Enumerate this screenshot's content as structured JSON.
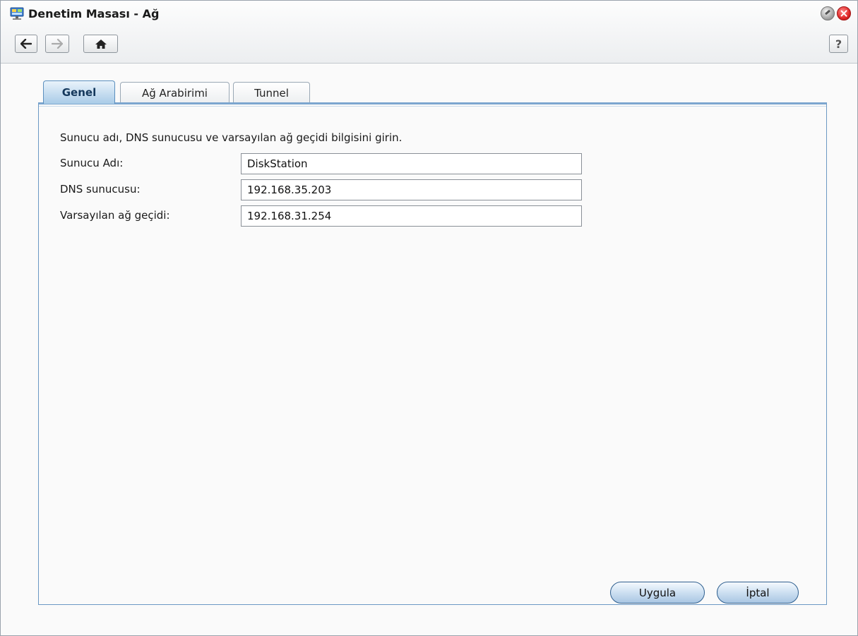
{
  "window": {
    "title": "Denetim Masası - Ağ",
    "icon": "network-monitor-icon",
    "controls": [
      "minimize-icon",
      "close-icon"
    ]
  },
  "toolbar": {
    "back_icon": "arrow-left-icon",
    "forward_icon": "arrow-right-icon",
    "home_icon": "home-icon",
    "help_label": "?"
  },
  "tabs": [
    {
      "label": "Genel",
      "active": true
    },
    {
      "label": "Ağ Arabirimi",
      "active": false
    },
    {
      "label": "Tunnel",
      "active": false
    }
  ],
  "form": {
    "description": "Sunucu adı, DNS sunucusu ve varsayılan ağ geçidi bilgisini girin.",
    "fields": [
      {
        "label": "Sunucu Adı:",
        "value": "DiskStation"
      },
      {
        "label": "DNS sunucusu:",
        "value": "192.168.35.203"
      },
      {
        "label": "Varsayılan ağ geçidi:",
        "value": "192.168.31.254"
      }
    ]
  },
  "buttons": {
    "apply": "Uygula",
    "cancel": "İptal"
  },
  "colors": {
    "accent": "#7ca6cf",
    "active_tab_text": "#14385c",
    "close_button": "#e02828"
  }
}
